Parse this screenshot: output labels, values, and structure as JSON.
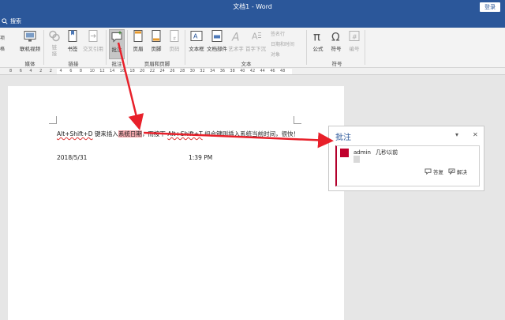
{
  "window": {
    "title": "文档1 - Word",
    "login_label": "登录"
  },
  "tellme": {
    "placeholder": "搜索"
  },
  "ribbon": {
    "buttons": [
      {
        "label": "联机视频",
        "icon": "online-video-icon"
      },
      {
        "label": "链接",
        "icon": "link-icon"
      },
      {
        "label": "书签",
        "icon": "bookmark-icon"
      },
      {
        "label": "交叉引用",
        "icon": "cross-reference-icon"
      },
      {
        "label": "批注",
        "icon": "comment-icon"
      },
      {
        "label": "页眉",
        "icon": "header-icon"
      },
      {
        "label": "页脚",
        "icon": "footer-icon"
      },
      {
        "label": "页码",
        "icon": "page-number-icon"
      },
      {
        "label": "文本框",
        "icon": "textbox-icon"
      },
      {
        "label": "文档部件",
        "icon": "quick-parts-icon"
      },
      {
        "label": "艺术字",
        "icon": "wordart-icon"
      },
      {
        "label": "首字下沉",
        "icon": "drop-cap-icon"
      },
      {
        "label": "公式",
        "icon": "equation-icon"
      },
      {
        "label": "符号",
        "icon": "symbol-icon"
      },
      {
        "label": "编号",
        "icon": "numbering-icon"
      }
    ],
    "small_items": [
      "签名行",
      "日期和时间",
      "对象"
    ],
    "groups": [
      "媒体",
      "链接",
      "批注",
      "页眉和页脚",
      "文本",
      "符号"
    ],
    "left_cut": [
      "项",
      "格"
    ]
  },
  "ruler": {
    "ticks": [
      "8",
      "6",
      "4",
      "2",
      "2",
      "4",
      "6",
      "8",
      "10",
      "12",
      "14",
      "16",
      "18",
      "20",
      "22",
      "24",
      "26",
      "28",
      "30",
      "32",
      "34",
      "36",
      "38",
      "40",
      "42",
      "44",
      "46",
      "48"
    ]
  },
  "document": {
    "line1_a": "Alt+Shift+D",
    "line1_b": " 键来插入",
    "line1_hl": "系统日期",
    "line1_c": "，而按下 ",
    "line1_d": "Alt+Shift+T",
    "line1_e": " 组合键则插入系统当前时间，很快！",
    "date": "2018/5/31",
    "time": "1:39 PM"
  },
  "comments": {
    "title": "批注",
    "author": "admin",
    "when": "几秒以前",
    "reply": "答复",
    "resolve": "解决"
  },
  "colors": {
    "accent": "#2b579a",
    "highlight": "#f4a9ae",
    "arrow": "#e8202a"
  }
}
